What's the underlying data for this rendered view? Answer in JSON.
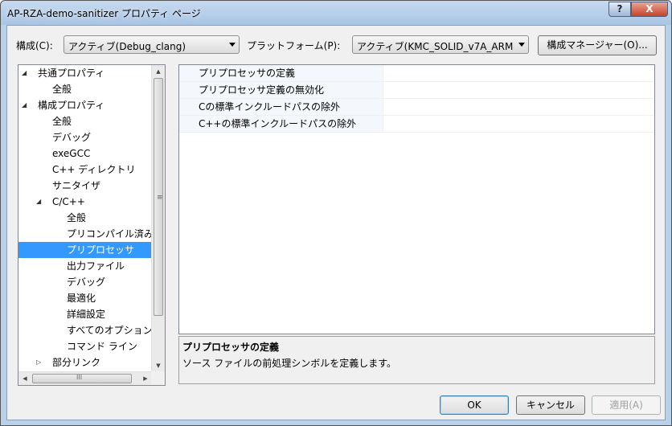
{
  "window": {
    "title": "AP-RZA-demo-sanitizer プロパティ ページ",
    "help_label": "?",
    "close_label": "X"
  },
  "toolbar": {
    "config_label": "構成(C):",
    "config_value": "アクティブ(Debug_clang)",
    "platform_label": "プラットフォーム(P):",
    "platform_value": "アクティブ(KMC_SOLID_v7A_ARM",
    "config_manager_label": "構成マネージャー(O)..."
  },
  "tree": {
    "items": [
      {
        "label": "共通プロパティ",
        "expander": "◢"
      },
      {
        "label": "全般"
      },
      {
        "label": "構成プロパティ",
        "expander": "◢"
      },
      {
        "label": "全般"
      },
      {
        "label": "デバッグ"
      },
      {
        "label": "exeGCC"
      },
      {
        "label": "C++ ディレクトリ"
      },
      {
        "label": "サニタイザ"
      },
      {
        "label": "C/C++",
        "expander": "◢"
      },
      {
        "label": "全般"
      },
      {
        "label": "プリコンパイル済み"
      },
      {
        "label": "プリプロセッサ"
      },
      {
        "label": "出力ファイル"
      },
      {
        "label": "デバッグ"
      },
      {
        "label": "最適化"
      },
      {
        "label": "詳細設定"
      },
      {
        "label": "すべてのオプション"
      },
      {
        "label": "コマンド ライン"
      },
      {
        "label": "部分リンク",
        "expander": "▷"
      }
    ],
    "grip": "≡",
    "hgrip": "III"
  },
  "grid": {
    "rows": [
      {
        "name": "プリプロセッサの定義",
        "value": ""
      },
      {
        "name": "プリプロセッサ定義の無効化",
        "value": ""
      },
      {
        "name": "Cの標準インクルードパスの除外",
        "value": ""
      },
      {
        "name": "C++の標準インクルードパスの除外",
        "value": ""
      }
    ]
  },
  "description": {
    "title": "プリプロセッサの定義",
    "text": "ソース ファイルの前処理シンボルを定義します。"
  },
  "buttons": {
    "ok": "OK",
    "cancel": "キャンセル",
    "apply": "適用(A)"
  }
}
